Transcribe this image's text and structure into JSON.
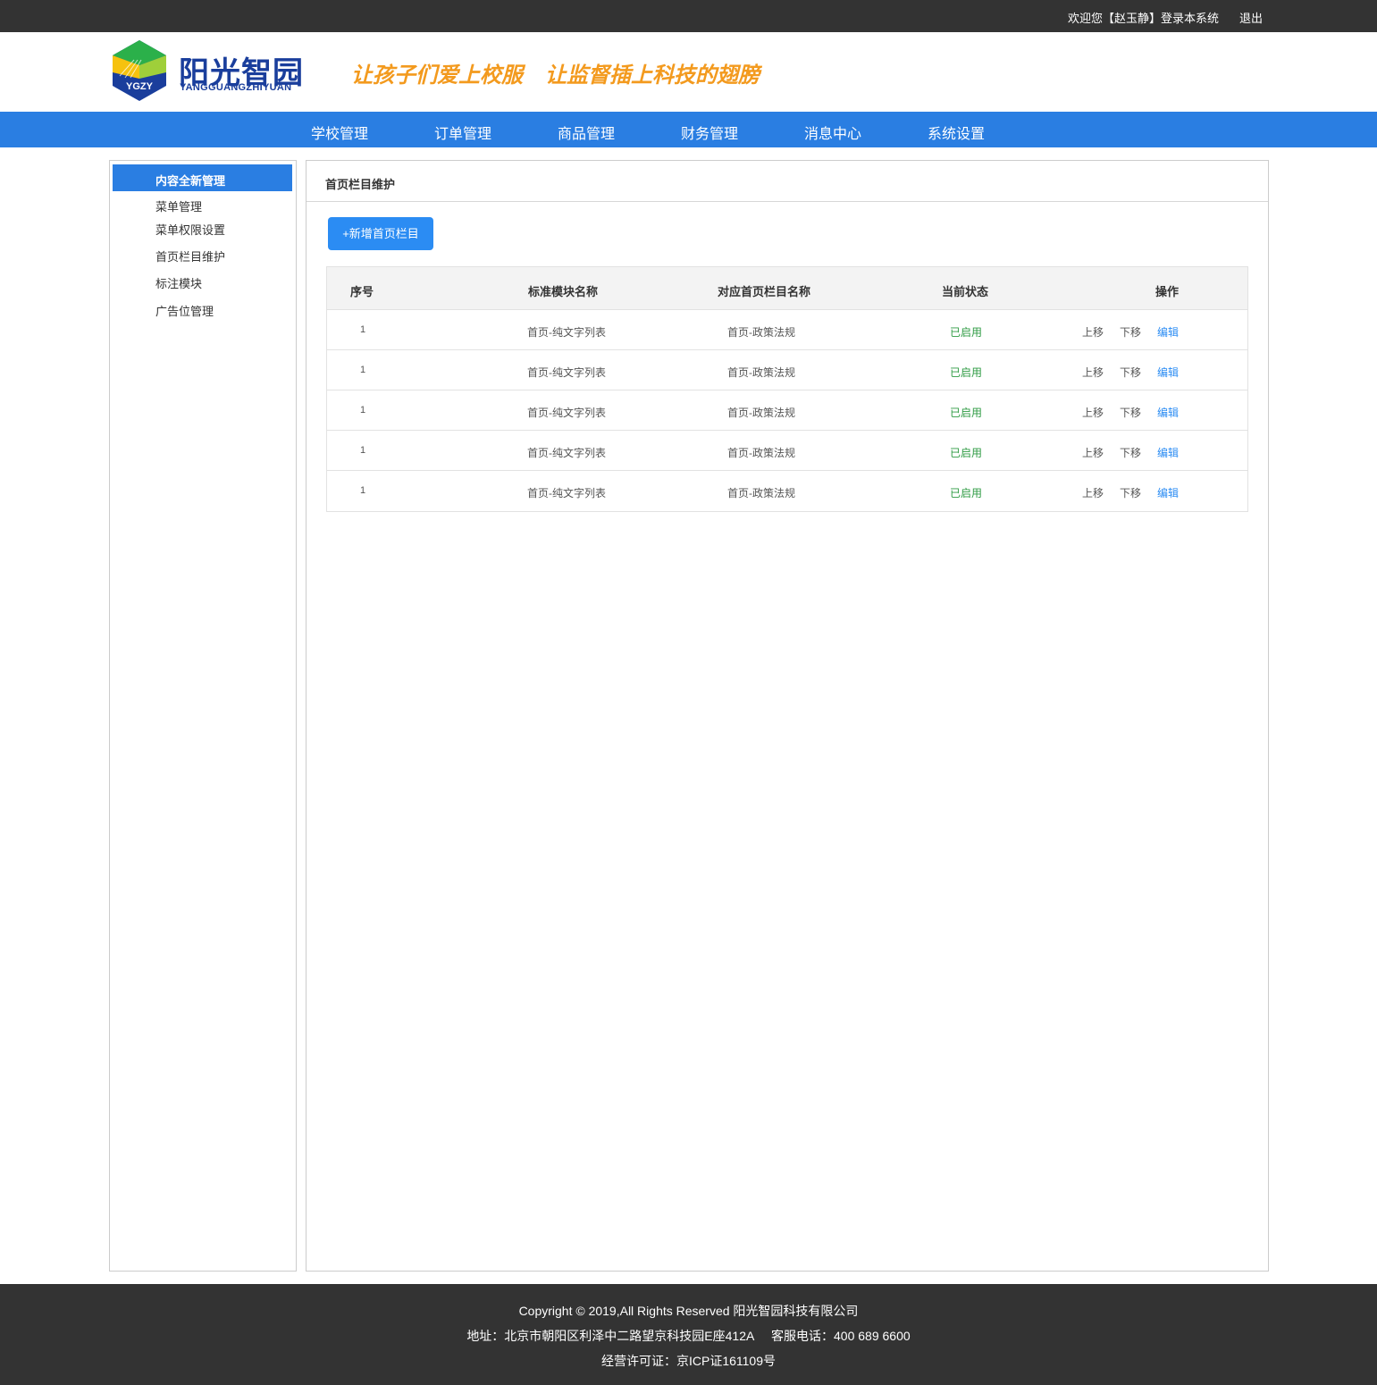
{
  "topbar": {
    "welcome": "欢迎您【赵玉静】登录本系统",
    "logout": "退出"
  },
  "header": {
    "logo_badge": "YGZY",
    "logo_cn": "阳光智园",
    "logo_en": "YANGGUANGZHIYUAN",
    "slogan_1": "让孩子们爱上校服",
    "slogan_2": "让监督插上科技的翅膀"
  },
  "nav": {
    "items": [
      "学校管理",
      "订单管理",
      "商品管理",
      "财务管理",
      "消息中心",
      "系统设置"
    ]
  },
  "sidebar": {
    "heading": "内容全新管理",
    "items": [
      "菜单管理",
      "菜单权限设置",
      "首页栏目维护",
      "标注模块",
      "广告位管理"
    ]
  },
  "main": {
    "title": "首页栏目维护",
    "add_button": "+新增首页栏目",
    "table": {
      "headers": [
        "序号",
        "标准模块名称",
        "对应首页栏目名称",
        "当前状态",
        "操作"
      ],
      "rows": [
        {
          "no": "1",
          "module": "首页-纯文字列表",
          "column": "首页-政策法规",
          "status": "已启用",
          "up": "上移",
          "down": "下移",
          "edit": "编辑"
        },
        {
          "no": "1",
          "module": "首页-纯文字列表",
          "column": "首页-政策法规",
          "status": "已启用",
          "up": "上移",
          "down": "下移",
          "edit": "编辑"
        },
        {
          "no": "1",
          "module": "首页-纯文字列表",
          "column": "首页-政策法规",
          "status": "已启用",
          "up": "上移",
          "down": "下移",
          "edit": "编辑"
        },
        {
          "no": "1",
          "module": "首页-纯文字列表",
          "column": "首页-政策法规",
          "status": "已启用",
          "up": "上移",
          "down": "下移",
          "edit": "编辑"
        },
        {
          "no": "1",
          "module": "首页-纯文字列表",
          "column": "首页-政策法规",
          "status": "已启用",
          "up": "上移",
          "down": "下移",
          "edit": "编辑"
        }
      ]
    }
  },
  "footer": {
    "copyright": "Copyright © 2019,All Rights Reserved 阳光智园科技有限公司",
    "address": "地址：北京市朝阳区利泽中二路望京科技园E座412A     客服电话：400 689 6600",
    "license": "经营许可证：京ICP证161109号"
  },
  "colors": {
    "topbar": "#333333",
    "nav": "#2a7ee2",
    "accent_button": "#2b8cf3",
    "status_enabled": "#2e9b43",
    "slogan": "#f39a1e",
    "logo_text": "#1a3e9c"
  }
}
